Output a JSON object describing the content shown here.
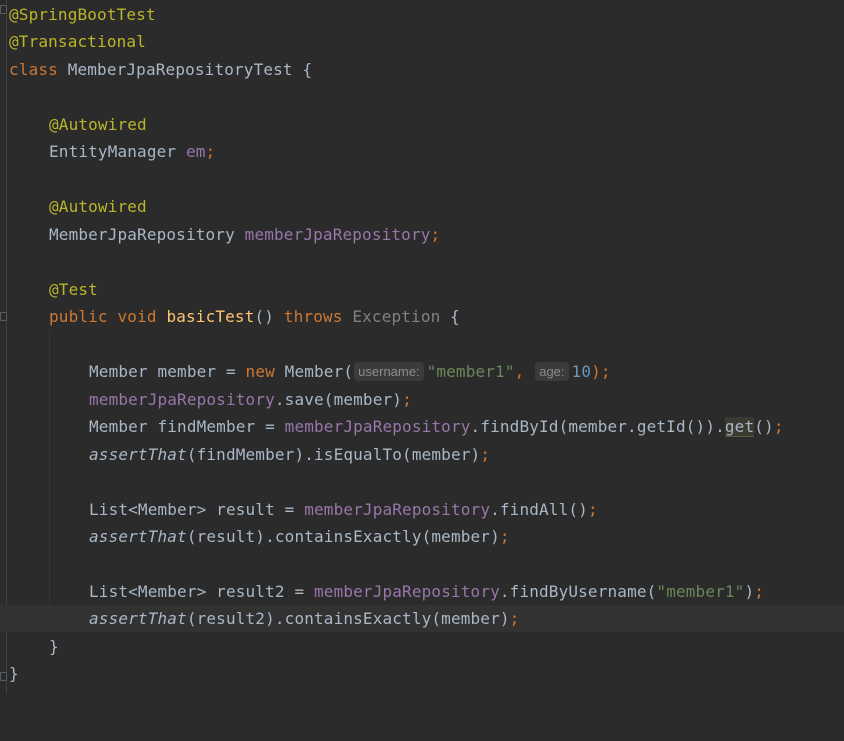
{
  "code": {
    "l1": "@SpringBootTest",
    "l2": "@Transactional",
    "l3_kw": "class",
    "l3_name": " MemberJpaRepositoryTest {",
    "l5": "@Autowired",
    "l6_type": "EntityManager ",
    "l6_field": "em",
    "l6_semi": ";",
    "l8": "@Autowired",
    "l9_type": "MemberJpaRepository ",
    "l9_field": "memberJpaRepository",
    "l9_semi": ";",
    "l11": "@Test",
    "l12_kw1": "public",
    "l12_kw2": "void",
    "l12_fn": "basicTest",
    "l12_paren": "() ",
    "l12_kw3": "throws",
    "l12_exc": "Exception",
    "l12_brace": " {",
    "l14_a": "Member member = ",
    "l14_new": "new",
    "l14_b": " Member(",
    "l14_hint1": "username:",
    "l14_str": "\"member1\"",
    "l14_comma": ",",
    "l14_hint2": "age:",
    "l14_num": "10",
    "l14_end": ");",
    "l15_field": "memberJpaRepository",
    "l15_rest": ".save(member)",
    "l15_semi": ";",
    "l16_a": "Member findMember = ",
    "l16_field": "memberJpaRepository",
    "l16_b": ".findById(member.getId()).",
    "l16_get": "get",
    "l16_c": "()",
    "l16_semi": ";",
    "l17_fn": "assertThat",
    "l17_rest": "(findMember).isEqualTo(member)",
    "l17_semi": ";",
    "l19_a": "List<Member> result = ",
    "l19_field": "memberJpaRepository",
    "l19_b": ".findAll()",
    "l19_semi": ";",
    "l20_fn": "assertThat",
    "l20_rest": "(result).containsExactly(member)",
    "l20_semi": ";",
    "l22_a": "List<Member> result2 = ",
    "l22_field": "memberJpaRepository",
    "l22_b": ".findByUsername(",
    "l22_str": "\"member1\"",
    "l22_c": ")",
    "l22_semi": ";",
    "l23_fn": "assertThat",
    "l23_rest": "(result2).containsExactly(member)",
    "l23_semi": ";",
    "l24": "}",
    "l25": "}"
  },
  "colors": {
    "background": "#2b2b2b",
    "current_line": "#323232",
    "annotation": "#bbb529",
    "keyword": "#cc7832",
    "field": "#9876aa",
    "string": "#6a8759",
    "number": "#6897bb",
    "method_decl": "#ffc66d",
    "plain": "#a9b7c6"
  }
}
